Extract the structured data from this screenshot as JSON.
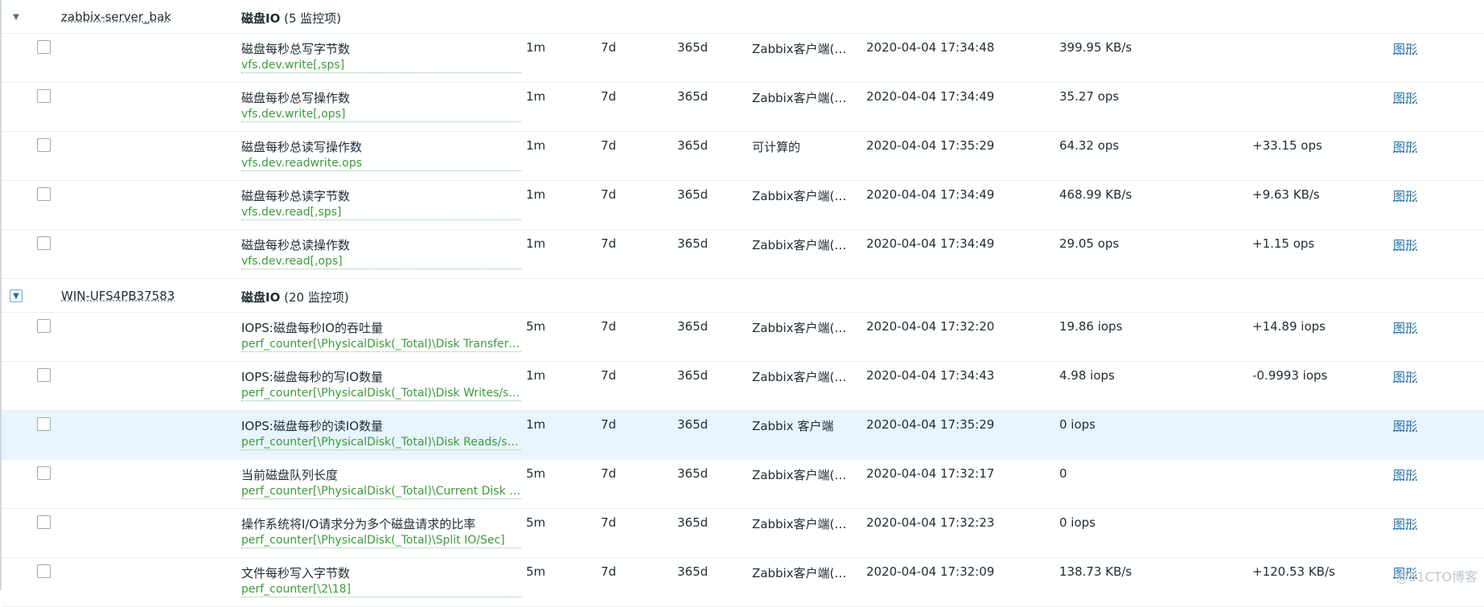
{
  "groups": [
    {
      "host": "zabbix-server_bak",
      "app_name": "磁盘IO",
      "app_count": "(5 监控项)",
      "toggle_boxed": false,
      "items": [
        {
          "name": "磁盘每秒总写字节数",
          "key": "vfs.dev.write[,sps]",
          "interval": "1m",
          "history": "7d",
          "trends": "365d",
          "type": "Zabbix客户端(主...",
          "lastcheck": "2020-04-04 17:34:48",
          "lastvalue": "399.95 KB/s",
          "change": "",
          "graph": "图形"
        },
        {
          "name": "磁盘每秒总写操作数",
          "key": "vfs.dev.write[,ops]",
          "interval": "1m",
          "history": "7d",
          "trends": "365d",
          "type": "Zabbix客户端(主...",
          "lastcheck": "2020-04-04 17:34:49",
          "lastvalue": "35.27 ops",
          "change": "",
          "graph": "图形"
        },
        {
          "name": "磁盘每秒总读写操作数",
          "key": "vfs.dev.readwrite.ops",
          "interval": "1m",
          "history": "7d",
          "trends": "365d",
          "type": "可计算的",
          "lastcheck": "2020-04-04 17:35:29",
          "lastvalue": "64.32 ops",
          "change": "+33.15 ops",
          "graph": "图形"
        },
        {
          "name": "磁盘每秒总读字节数",
          "key": "vfs.dev.read[,sps]",
          "interval": "1m",
          "history": "7d",
          "trends": "365d",
          "type": "Zabbix客户端(主...",
          "lastcheck": "2020-04-04 17:34:49",
          "lastvalue": "468.99 KB/s",
          "change": "+9.63 KB/s",
          "graph": "图形"
        },
        {
          "name": "磁盘每秒总读操作数",
          "key": "vfs.dev.read[,ops]",
          "interval": "1m",
          "history": "7d",
          "trends": "365d",
          "type": "Zabbix客户端(主...",
          "lastcheck": "2020-04-04 17:34:49",
          "lastvalue": "29.05 ops",
          "change": "+1.15 ops",
          "graph": "图形"
        }
      ]
    },
    {
      "host": "WIN-UFS4PB37583",
      "app_name": "磁盘IO",
      "app_count": "(20 监控项)",
      "toggle_boxed": true,
      "items": [
        {
          "name": "IOPS:磁盘每秒IO的吞吐量",
          "key": "perf_counter[\\PhysicalDisk(_Total)\\Disk Transfers/...",
          "interval": "5m",
          "history": "7d",
          "trends": "365d",
          "type": "Zabbix客户端(主...",
          "lastcheck": "2020-04-04 17:32:20",
          "lastvalue": "19.86 iops",
          "change": "+14.89 iops",
          "graph": "图形"
        },
        {
          "name": "IOPS:磁盘每秒的写IO数量",
          "key": "perf_counter[\\PhysicalDisk(_Total)\\Disk Writes/sec]",
          "interval": "1m",
          "history": "7d",
          "trends": "365d",
          "type": "Zabbix客户端(主...",
          "lastcheck": "2020-04-04 17:34:43",
          "lastvalue": "4.98 iops",
          "change": "-0.9993 iops",
          "graph": "图形"
        },
        {
          "name": "IOPS:磁盘每秒的读IO数量",
          "key": "perf_counter[\\PhysicalDisk(_Total)\\Disk Reads/sec]",
          "interval": "1m",
          "history": "7d",
          "trends": "365d",
          "type": "Zabbix 客户端",
          "lastcheck": "2020-04-04 17:35:29",
          "lastvalue": "0 iops",
          "change": "",
          "graph": "图形",
          "highlight": true
        },
        {
          "name": "当前磁盘队列长度",
          "key": "perf_counter[\\PhysicalDisk(_Total)\\Current Disk Q...",
          "interval": "5m",
          "history": "7d",
          "trends": "365d",
          "type": "Zabbix客户端(主...",
          "lastcheck": "2020-04-04 17:32:17",
          "lastvalue": "0",
          "change": "",
          "graph": "图形"
        },
        {
          "name": "操作系统将I/O请求分为多个磁盘请求的比率",
          "key": "perf_counter[\\PhysicalDisk(_Total)\\Split IO/Sec]",
          "interval": "5m",
          "history": "7d",
          "trends": "365d",
          "type": "Zabbix客户端(主...",
          "lastcheck": "2020-04-04 17:32:23",
          "lastvalue": "0 iops",
          "change": "",
          "graph": "图形"
        },
        {
          "name": "文件每秒写入字节数",
          "key": "perf_counter[\\2\\18]",
          "interval": "5m",
          "history": "7d",
          "trends": "365d",
          "type": "Zabbix客户端(主...",
          "lastcheck": "2020-04-04 17:32:09",
          "lastvalue": "138.73 KB/s",
          "change": "+120.53 KB/s",
          "graph": "图形"
        }
      ]
    }
  ],
  "watermark": "@51CTO博客"
}
